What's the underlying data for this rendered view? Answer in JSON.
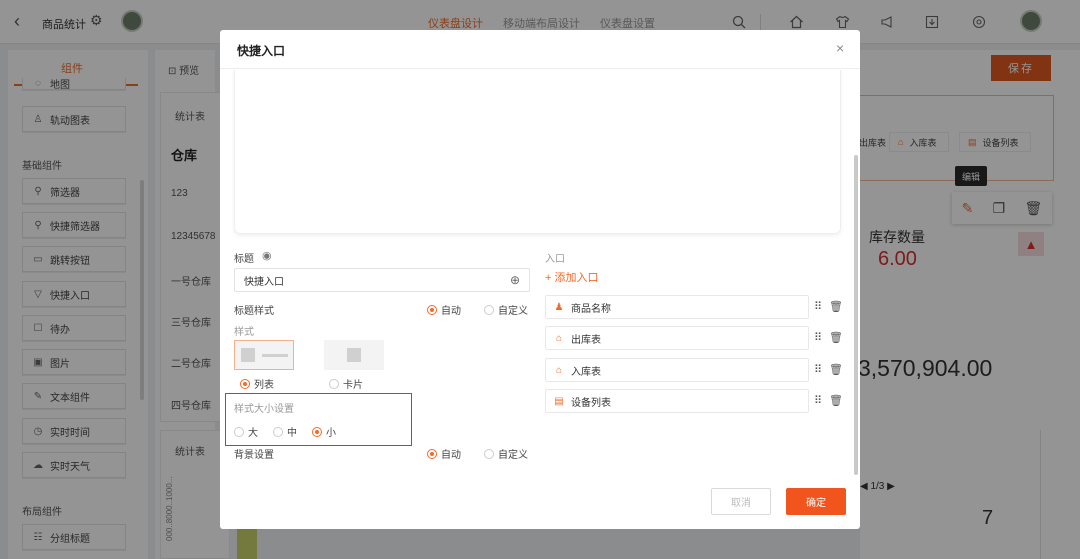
{
  "topbar": {
    "back": "‹",
    "title": "商品统计",
    "tabs": [
      "仪表盘设计",
      "移动端布局设计",
      "仪表盘设置"
    ]
  },
  "left": {
    "tab_label": "组件",
    "top_item_label": "地图",
    "track_label": "轨动图表",
    "section_basic": "基础组件",
    "basic_items": [
      "筛选器",
      "快捷筛选器",
      "跳转按钮",
      "快捷入口",
      "待办",
      "图片",
      "文本组件",
      "实时时间",
      "实时天气"
    ],
    "section_layout": "布局组件",
    "layout_items": [
      "分组标题"
    ]
  },
  "middle": {
    "preview": "预览",
    "table_title": "统计表",
    "warehouse": "仓库",
    "rows": [
      "123",
      "12345678",
      "一号仓库",
      "三号仓库",
      "二号仓库",
      "四号仓库"
    ],
    "chart_title": "统计表",
    "y_axis": "000..8000..1000..."
  },
  "right": {
    "save": "保存",
    "chips": [
      "出库表",
      "入库表",
      "设备列表"
    ],
    "tooltip": "编辑",
    "stock_label": "库存数量",
    "stock_value": "6.00",
    "big_number": "3,570,904.00",
    "pager": "1/3",
    "count": "7",
    "legend_label": "三号仓库 1..."
  },
  "modal": {
    "title": "快捷入口",
    "close": "×",
    "title_label": "标题",
    "title_input": "快捷入口",
    "title_style_label": "标题样式",
    "auto": "自动",
    "custom": "自定义",
    "style_label": "样式",
    "style_list": "列表",
    "style_card": "卡片",
    "size_label": "样式大小设置",
    "size_large": "大",
    "size_medium": "中",
    "size_small": "小",
    "bg_label": "背景设置",
    "bg_auto": "自动",
    "bg_custom": "自定义",
    "entry_label": "入口",
    "add_entry": "添加入口",
    "entries": [
      "商品名称",
      "出库表",
      "入库表",
      "设备列表"
    ],
    "cancel": "取消",
    "ok": "确定"
  },
  "colors": {
    "accent": "#f26b2a",
    "highlight": "#d9302f",
    "stock_value": "#d9302f"
  }
}
